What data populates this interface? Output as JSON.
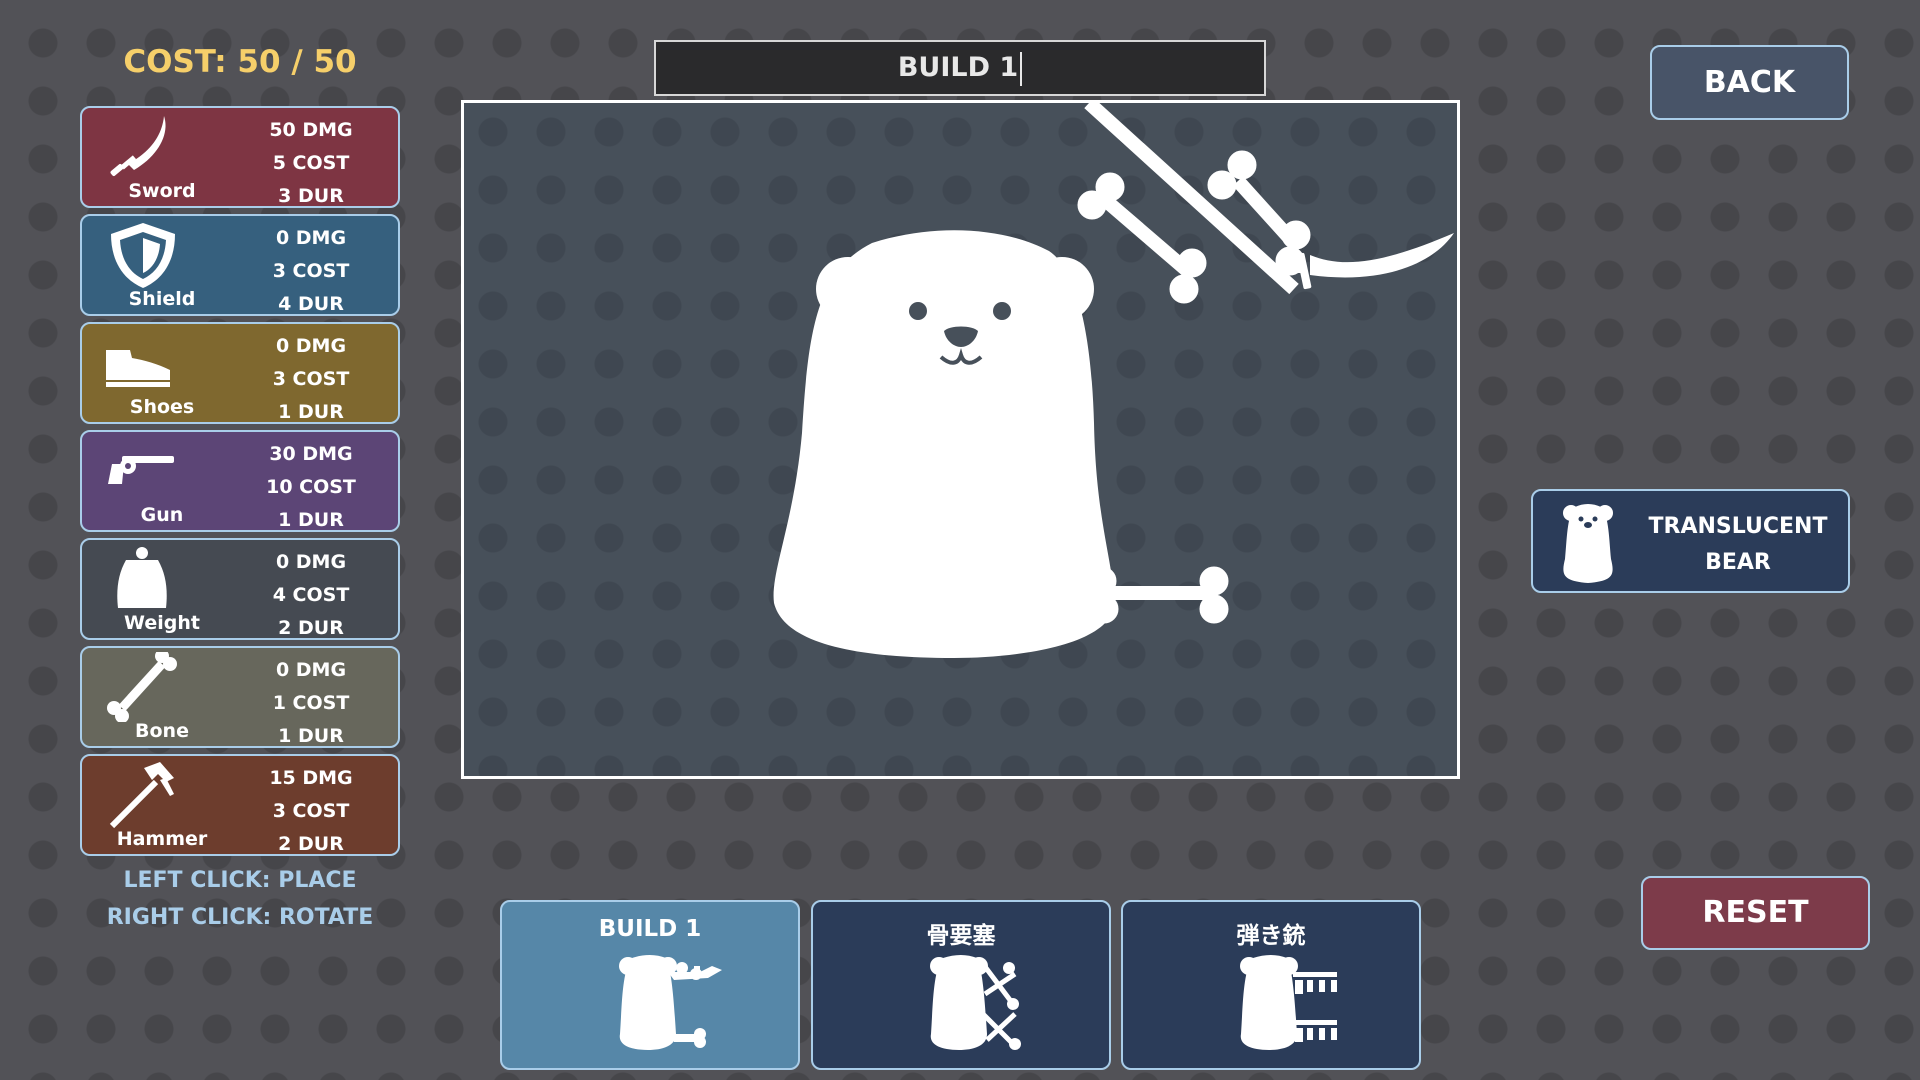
{
  "header": {
    "cost": "COST: 50 / 50"
  },
  "items": [
    {
      "name": "Sword",
      "dmg": "50 DMG",
      "cost": "5 COST",
      "dur": "3 DUR",
      "icon": "sword-icon",
      "color": "#7e3543"
    },
    {
      "name": "Shield",
      "dmg": "0 DMG",
      "cost": "3 COST",
      "dur": "4 DUR",
      "icon": "shield-icon",
      "color": "#36607e"
    },
    {
      "name": "Shoes",
      "dmg": "0 DMG",
      "cost": "3 COST",
      "dur": "1 DUR",
      "icon": "shoe-icon",
      "color": "#7f682f"
    },
    {
      "name": "Gun",
      "dmg": "30 DMG",
      "cost": "10 COST",
      "dur": "1 DUR",
      "icon": "gun-icon",
      "color": "#5c4576"
    },
    {
      "name": "Weight",
      "dmg": "0 DMG",
      "cost": "4 COST",
      "dur": "2 DUR",
      "icon": "weight-icon",
      "color": "#454a52"
    },
    {
      "name": "Bone",
      "dmg": "0 DMG",
      "cost": "1 COST",
      "dur": "1 DUR",
      "icon": "bone-icon",
      "color": "#67675c"
    },
    {
      "name": "Hammer",
      "dmg": "15 DMG",
      "cost": "3 COST",
      "dur": "2 DUR",
      "icon": "hammer-icon",
      "color": "#6d3d2d"
    }
  ],
  "help": {
    "left_click": "LEFT CLICK: PLACE",
    "right_click": "RIGHT CLICK: ROTATE"
  },
  "name_field": {
    "value": "BUILD 1"
  },
  "buttons": {
    "back": "BACK",
    "reset": "RESET"
  },
  "character": {
    "line1": "TRANSLUCENT",
    "line2": "BEAR",
    "icon": "bear-icon"
  },
  "builds": [
    {
      "label": "BUILD 1",
      "selected": true,
      "color": "#5687a8"
    },
    {
      "label": "骨要塞",
      "selected": false,
      "color": "#2b3c59"
    },
    {
      "label": "弾き銃",
      "selected": false,
      "color": "#2b3c59"
    }
  ]
}
